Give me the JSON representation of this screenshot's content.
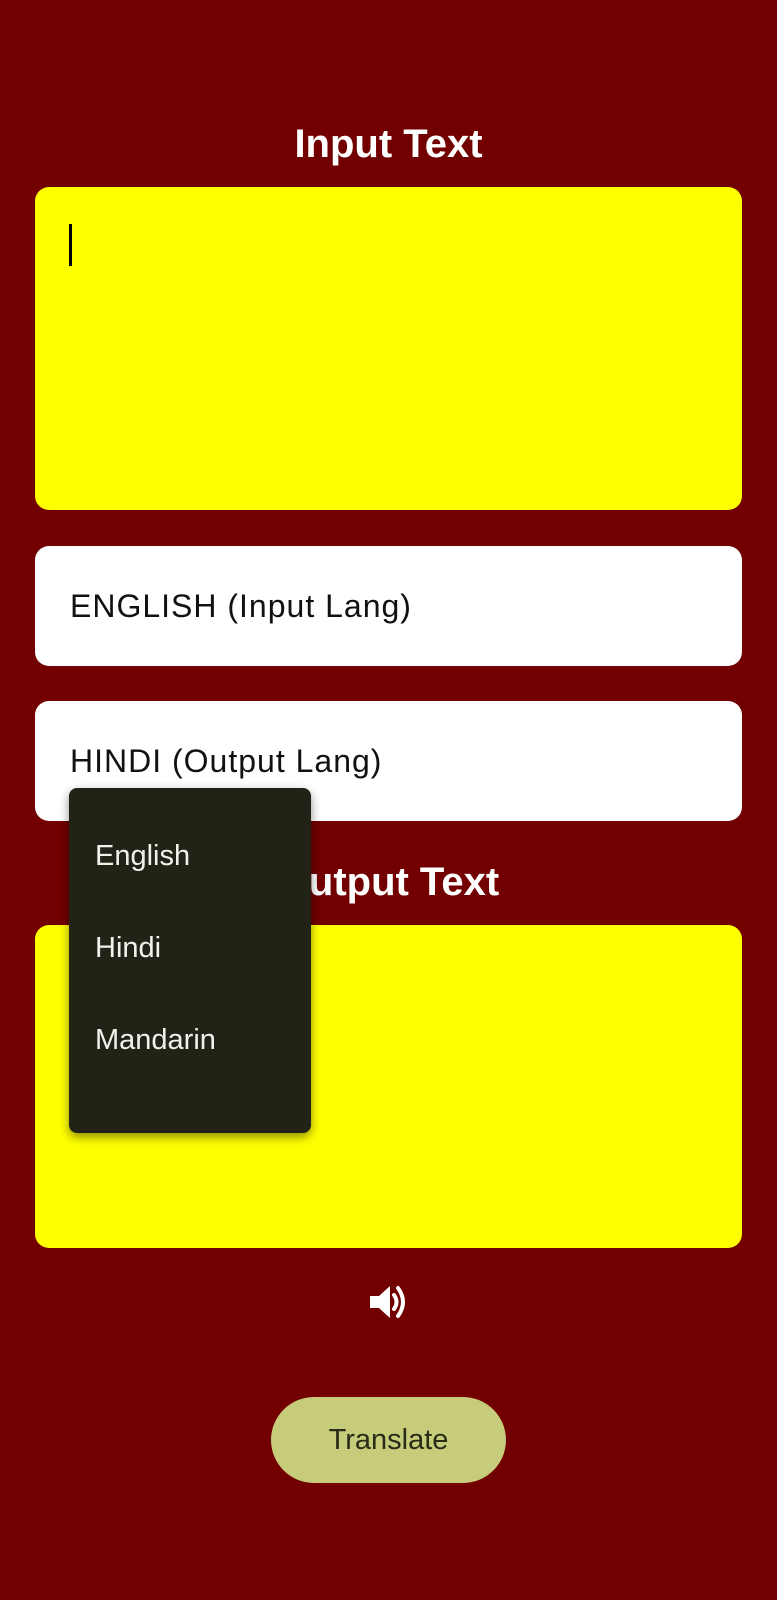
{
  "input_section": {
    "title": "Input Text",
    "value": "",
    "placeholder": ""
  },
  "input_language": {
    "selected": "ENGLISH (Input Lang)"
  },
  "output_language": {
    "selected": "HINDI (Output Lang)"
  },
  "language_menu": {
    "options": [
      "English",
      "Hindi",
      "Mandarin"
    ]
  },
  "output_section": {
    "title": "Output Text",
    "value": ""
  },
  "speaker": {
    "icon": "speaker-icon"
  },
  "translate_button": {
    "label": "Translate"
  },
  "colors": {
    "background": "#720000",
    "text_area": "#ffff00",
    "button": "#c6cc7a",
    "menu": "#222217"
  }
}
